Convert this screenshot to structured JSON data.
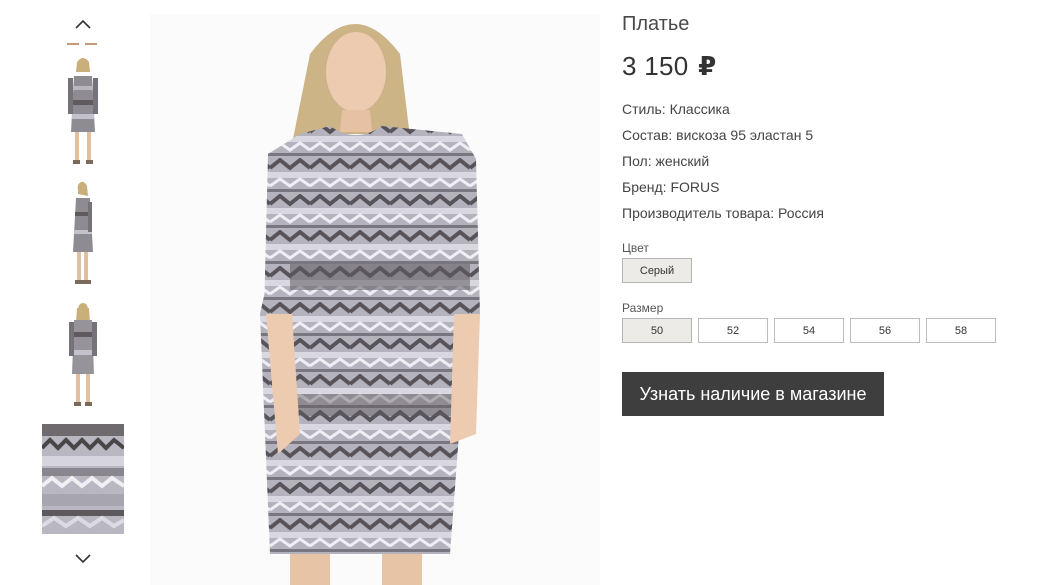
{
  "gallery": {
    "up_icon": "chevron-up-icon",
    "down_icon": "chevron-down-icon",
    "thumbnails": [
      "front view",
      "side view",
      "back view",
      "fabric close-up"
    ]
  },
  "product": {
    "title": "Платье",
    "price": "3 150",
    "currency": "₽",
    "attributes": [
      "Стиль: Классика",
      "Состав: вискоза 95 эластан 5",
      "Пол: женский",
      "Бренд: FORUS",
      "Производитель товара: Россия"
    ],
    "color_label": "Цвет",
    "colors": [
      "Серый"
    ],
    "selected_color": "Серый",
    "size_label": "Размер",
    "sizes": [
      "50",
      "52",
      "54",
      "56",
      "58"
    ],
    "selected_size": "50",
    "cta_label": "Узнать наличие в магазине"
  },
  "colors": {
    "cta_bg": "#3e3e3e",
    "selected_option_bg": "#ecebe8",
    "accent_mark": "#c89a78"
  }
}
